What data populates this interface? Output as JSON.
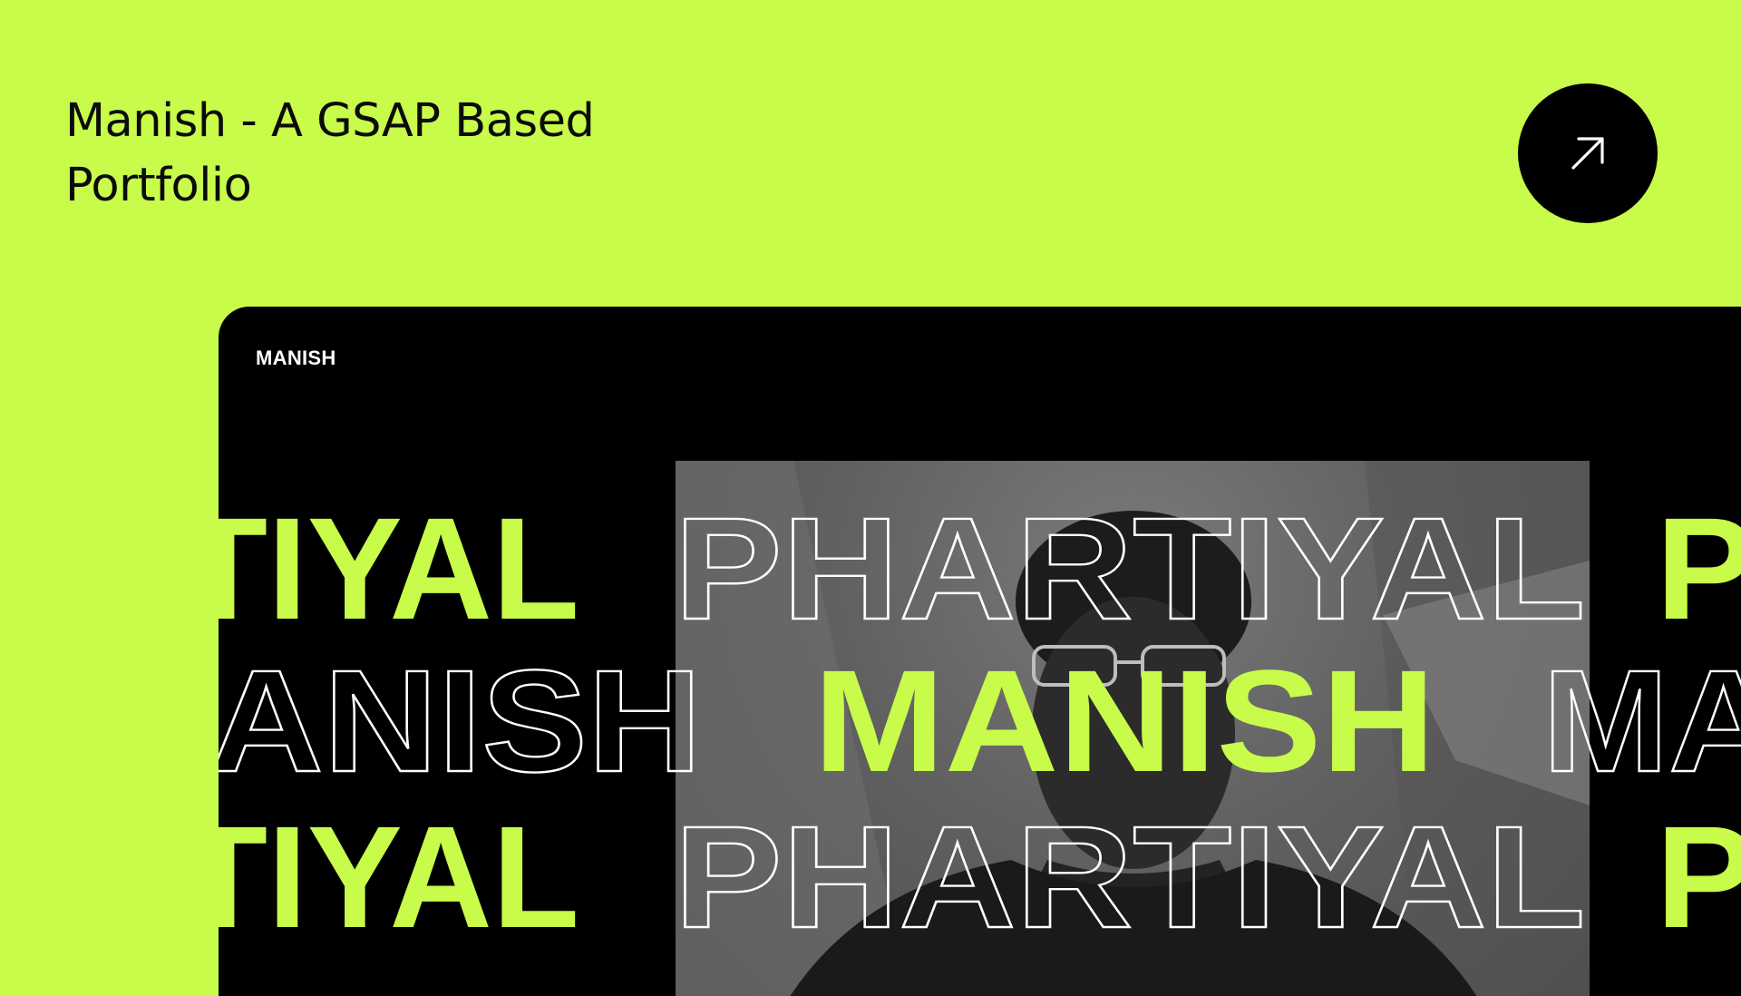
{
  "header": {
    "title_line1": "Manish - A GSAP Based",
    "title_line2": "Portfolio"
  },
  "actions": {
    "open_icon": "arrow-up-right-icon"
  },
  "preview": {
    "logo": "MANISH",
    "marquee": {
      "row1": [
        "TIYAL",
        "PHARTIYAL",
        "P"
      ],
      "row2": [
        "IANISH",
        "MANISH",
        "MA"
      ],
      "row3": [
        "TIYAL",
        "PHARTIYAL",
        "P"
      ]
    }
  },
  "colors": {
    "background": "#c8fb4a",
    "accent": "#c8fb4a",
    "frame": "#000000",
    "button": "#000000"
  }
}
